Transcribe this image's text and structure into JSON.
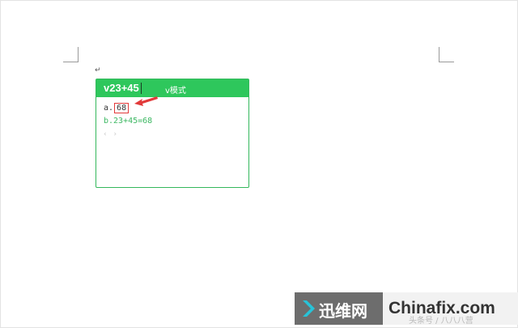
{
  "document": {
    "paragraph_mark": "↵"
  },
  "ime": {
    "input": "v23+45",
    "mode_label": "v模式",
    "candidate_a_prefix": "a.",
    "candidate_a_value": "68",
    "candidate_b": "b.23+45=68",
    "pager": "‹ ›"
  },
  "watermark": {
    "cn_name": "迅维网",
    "en_name": "Chinafix.com",
    "caption": "头条号 / 八八八营"
  },
  "colors": {
    "ime_green": "#2ec75c",
    "highlight_red": "#e23a3a"
  }
}
